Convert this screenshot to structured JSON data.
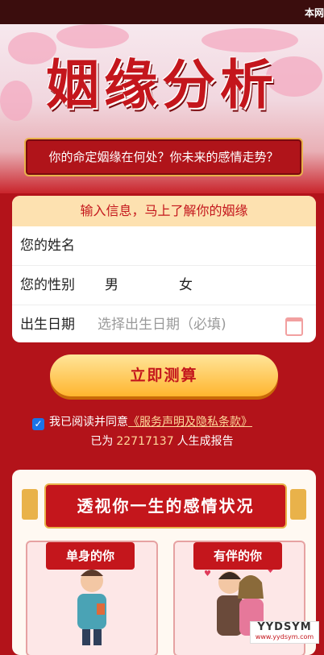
{
  "topbar": {
    "right_text": "本网"
  },
  "hero": {
    "title": "姻缘分析",
    "tagline": "你的命定姻缘在何处？你未来的感情走势？"
  },
  "form": {
    "header": "输入信息，马上了解你的姻缘",
    "name_label": "您的姓名",
    "name_placeholder": "",
    "gender_label": "您的性别",
    "gender_options": [
      "男",
      "女"
    ],
    "birth_label": "出生日期",
    "birth_placeholder": "选择出生日期（必填)"
  },
  "cta": {
    "label": "立即测算"
  },
  "agreement": {
    "prefix": "我已阅读并同意",
    "link": "《服务声明及隐私条款》"
  },
  "stats": {
    "prefix": "已为",
    "count": "22717137",
    "suffix": "人生成报告"
  },
  "section": {
    "title": "透视你一生的感情状况",
    "left_tag": "单身的你",
    "right_tag": "有伴的你"
  },
  "watermark": {
    "brand": "YYDSYM",
    "url": "www.yydsym.com"
  }
}
